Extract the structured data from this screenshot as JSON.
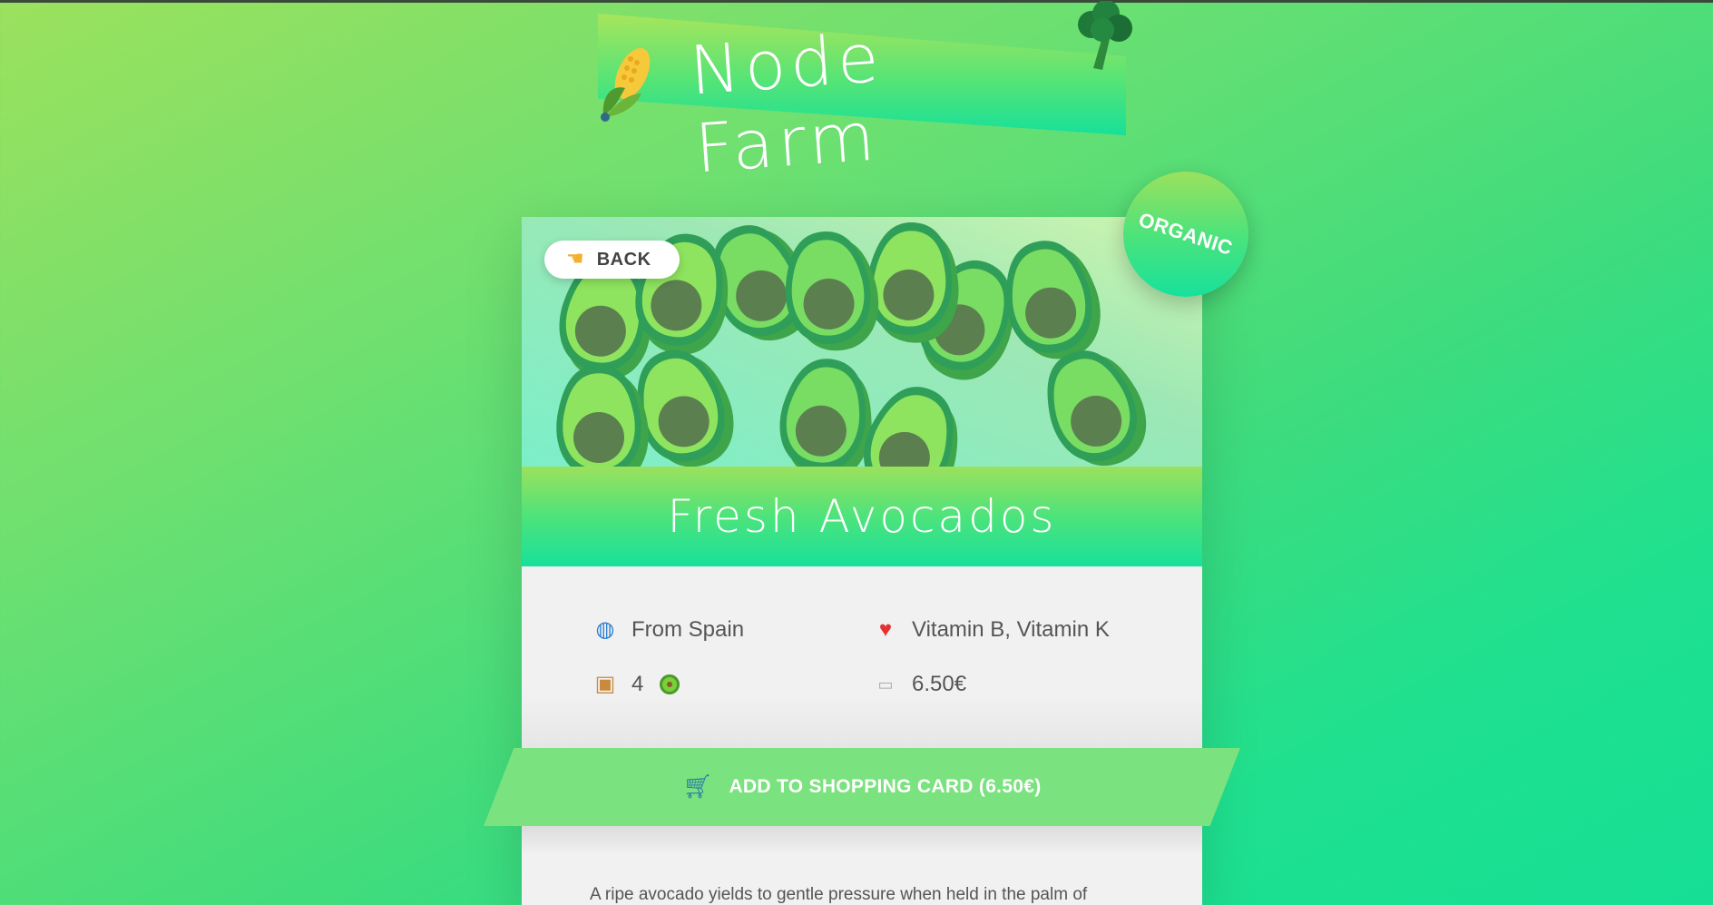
{
  "header": {
    "title": "Node Farm"
  },
  "product": {
    "back_label": "BACK",
    "name": "Fresh Avocados",
    "badge": "ORGANIC",
    "from": "From Spain",
    "nutrients": "Vitamin B, Vitamin K",
    "quantity": "4",
    "price": "6.50€",
    "cart_label": "ADD TO SHOPPING CARD (6.50€)",
    "description": "A ripe avocado yields to gentle pressure when held in the palm of"
  },
  "icons": {
    "header_left": "corn-icon",
    "header_right": "broccoli-icon",
    "back": "hand-pointing-left-icon",
    "from": "globe-icon",
    "nutrients": "heart-icon",
    "quantity": "package-icon",
    "quantity_unit": "avocado-icon",
    "price": "price-tag-icon",
    "cart": "shopping-cart-icon"
  },
  "colors": {
    "accent_green": "#7ae27e",
    "gradient_top": "#9be15d",
    "gradient_bottom": "#17e19b",
    "card_background": "#f1f1f1",
    "text": "#555555"
  }
}
